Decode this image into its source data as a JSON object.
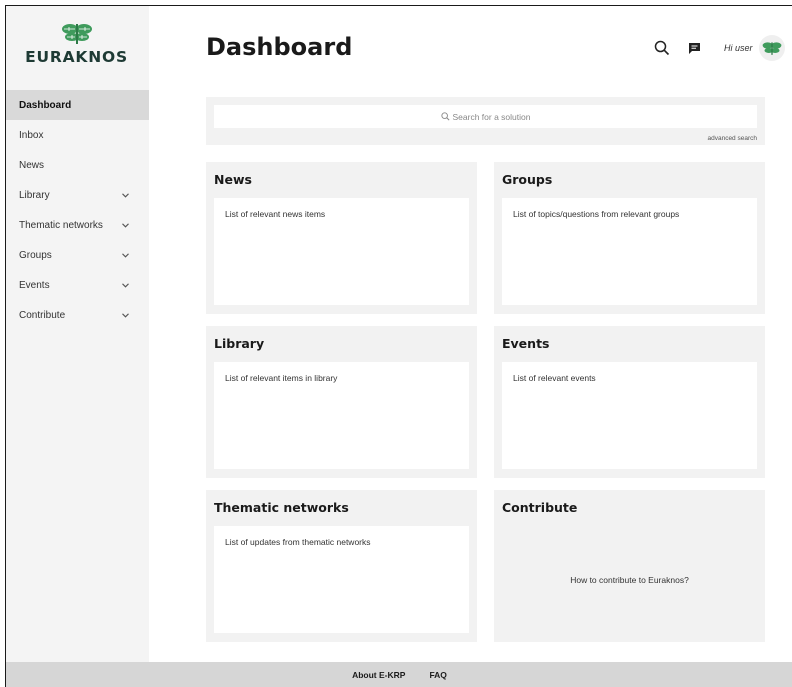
{
  "brand": {
    "name": "EURAKNOS",
    "color": "#3f9b5c",
    "logo_icon": "brain-tree-logo"
  },
  "sidebar": {
    "items": [
      {
        "label": "Dashboard",
        "active": true,
        "expandable": false
      },
      {
        "label": "Inbox",
        "active": false,
        "expandable": false
      },
      {
        "label": "News",
        "active": false,
        "expandable": false
      },
      {
        "label": "Library",
        "active": false,
        "expandable": true
      },
      {
        "label": "Thematic networks",
        "active": false,
        "expandable": true
      },
      {
        "label": "Groups",
        "active": false,
        "expandable": true
      },
      {
        "label": "Events",
        "active": false,
        "expandable": true
      },
      {
        "label": "Contribute",
        "active": false,
        "expandable": true
      }
    ]
  },
  "header": {
    "title": "Dashboard",
    "search_icon": "search-icon",
    "chat_icon": "chat-icon",
    "greeting": "Hi user",
    "avatar_icon": "brain-tree-logo"
  },
  "search": {
    "placeholder": "Search for a solution",
    "advanced_label": "advanced search"
  },
  "cards": {
    "news": {
      "title": "News",
      "body": "List of relevant news items"
    },
    "groups": {
      "title": "Groups",
      "body": "List of topics/questions from relevant groups"
    },
    "library": {
      "title": "Library",
      "body": "List of relevant items in library"
    },
    "events": {
      "title": "Events",
      "body": "List of relevant events"
    },
    "thematic": {
      "title": "Thematic networks",
      "body": "List of updates from thematic networks"
    },
    "contribute": {
      "title": "Contribute",
      "body": "How to contribute to Euraknos?"
    }
  },
  "footer": {
    "links": [
      "About E-KRP",
      "FAQ"
    ]
  }
}
